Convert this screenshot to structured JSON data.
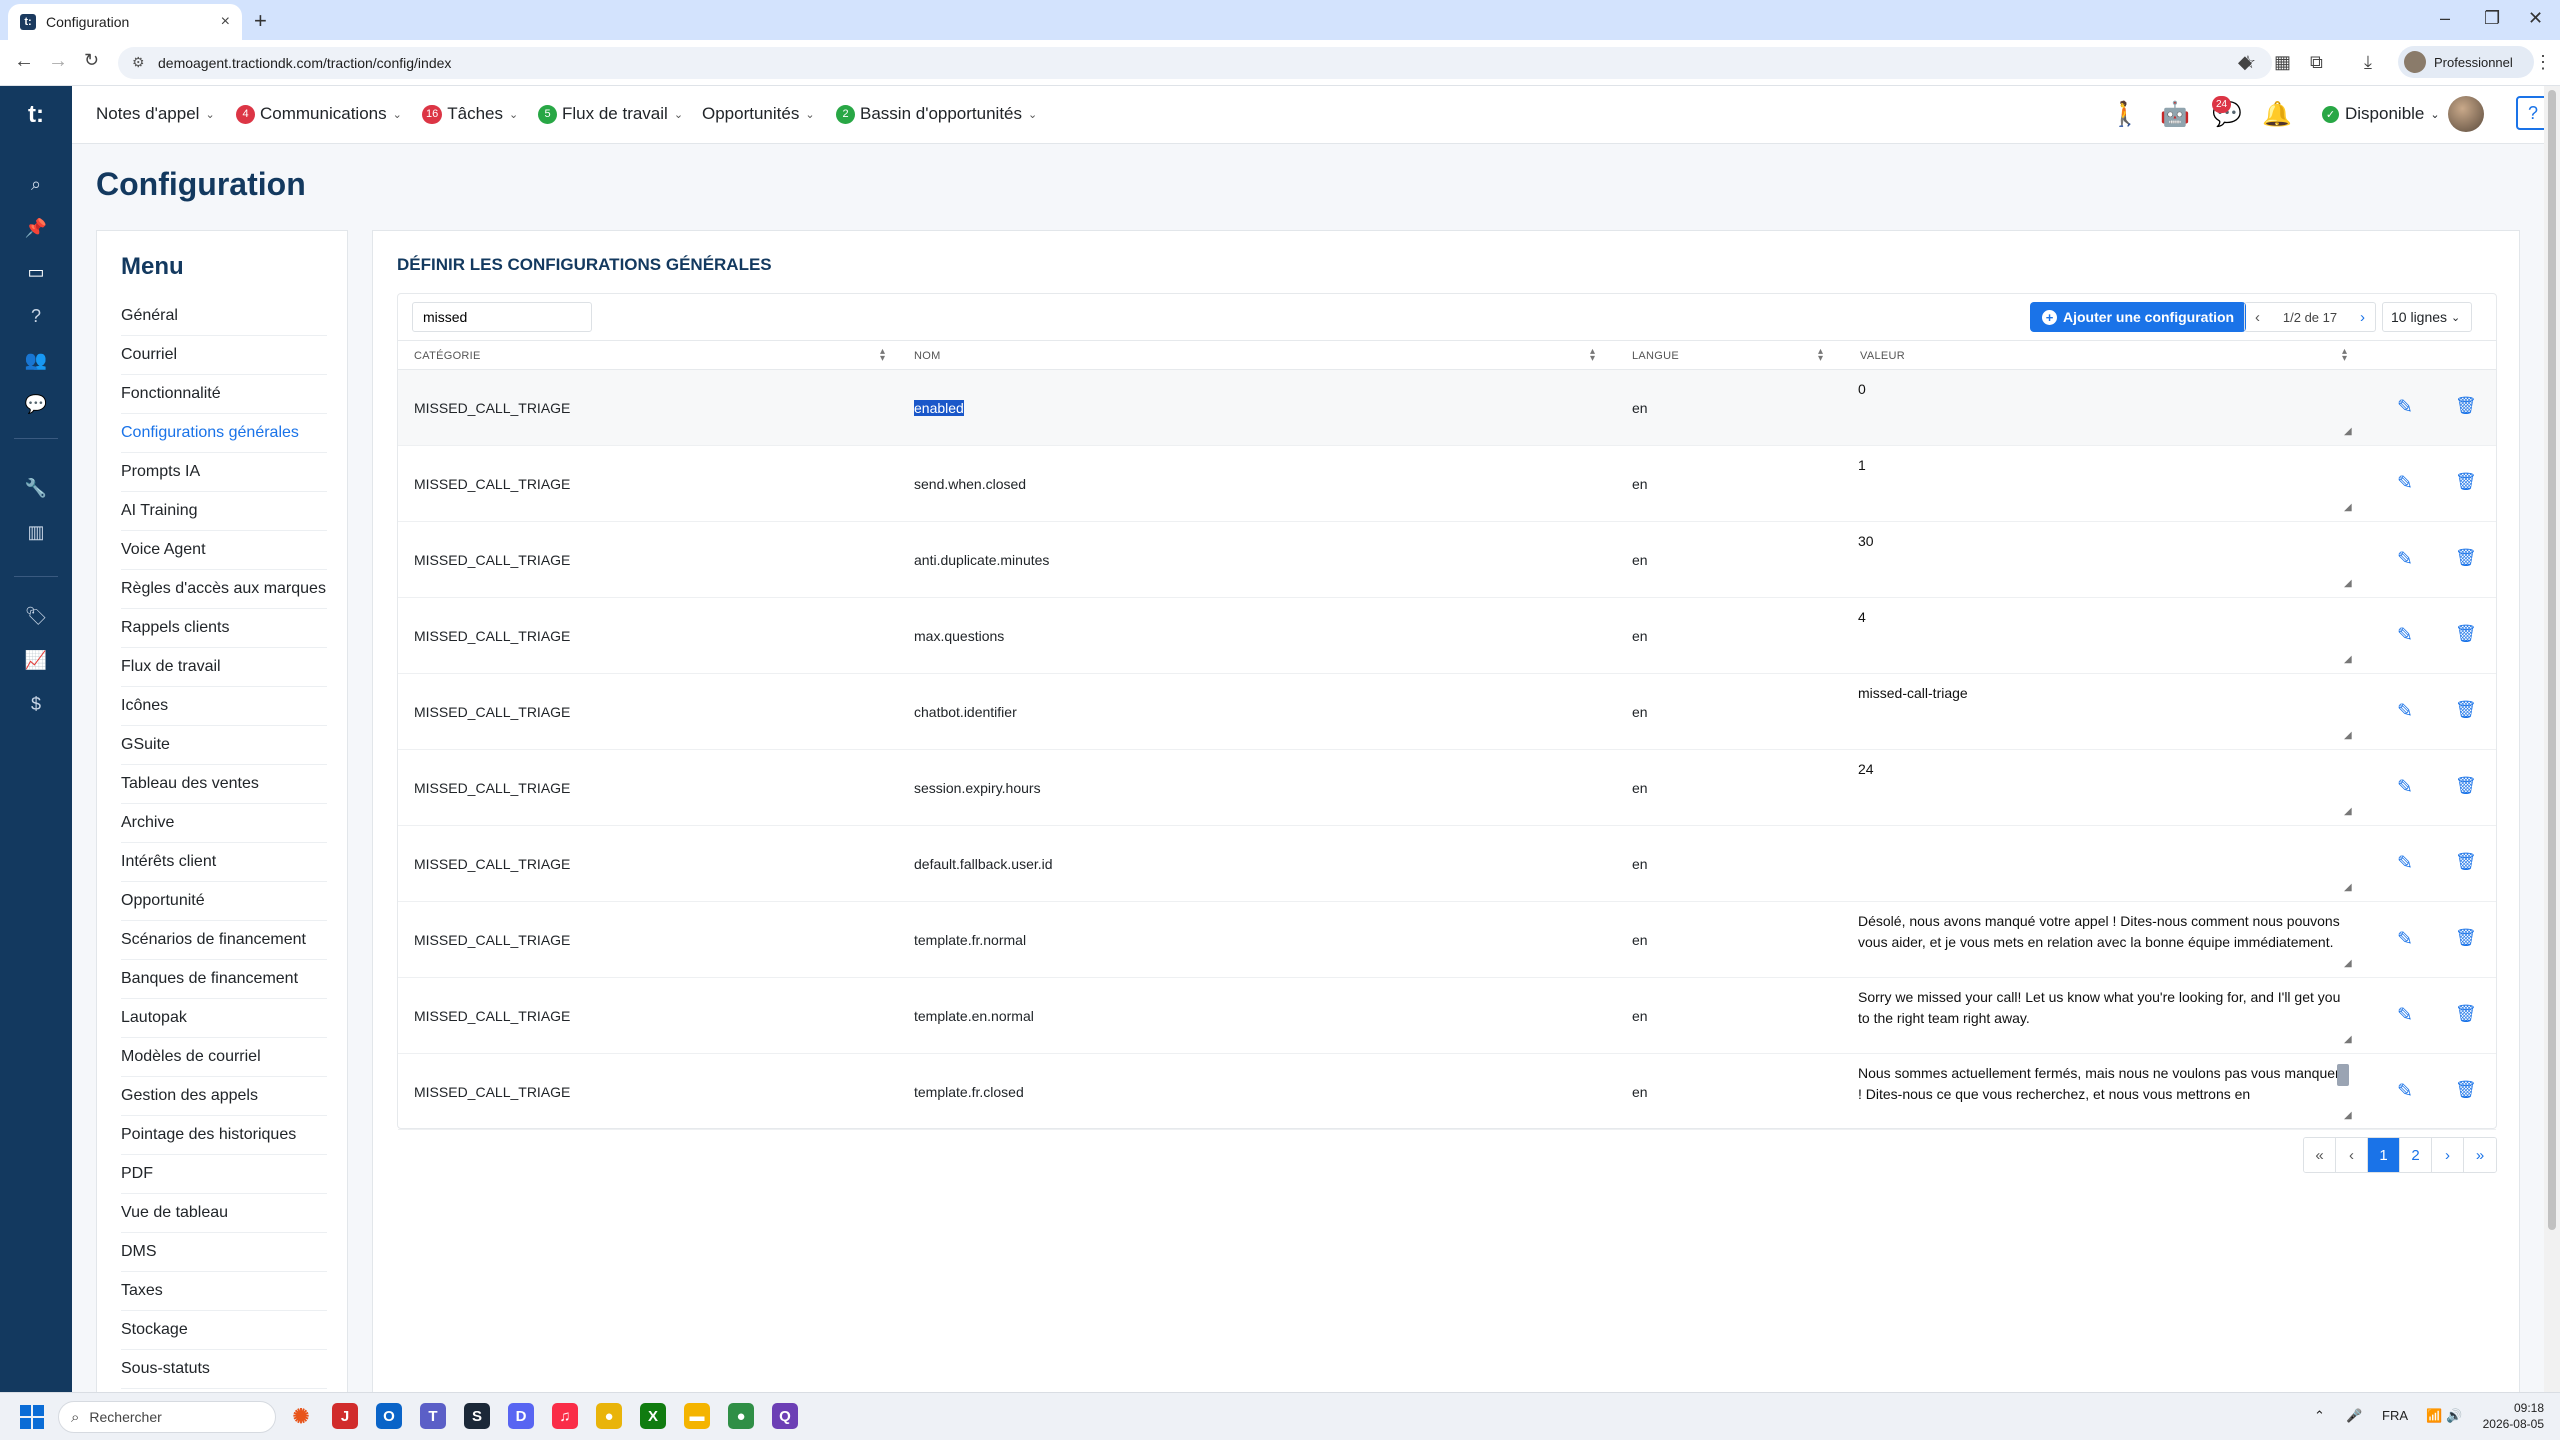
{
  "browser": {
    "tab_title": "Configuration",
    "url": "demoagent.tractiondk.com/traction/config/index",
    "profile_label": "Professionnel"
  },
  "rail": {
    "logo": "t:",
    "icons": [
      "search-icon",
      "pin-icon",
      "monitor-icon",
      "help-circle-icon",
      "users-icon",
      "chat-icon",
      "wrench-icon",
      "board-icon",
      "tag-icon",
      "chart-icon",
      "dollar-icon"
    ]
  },
  "nav": {
    "items": [
      {
        "label": "Notes d'appel",
        "badge": ""
      },
      {
        "label": "Communications",
        "badge": "4",
        "badge_color": "#dc3545"
      },
      {
        "label": "Tâches",
        "badge": "16",
        "badge_color": "#dc3545"
      },
      {
        "label": "Flux de travail",
        "badge": "5",
        "badge_color": "#28a745"
      },
      {
        "label": "Opportunités",
        "badge": ""
      },
      {
        "label": "Bassin d'opportunités",
        "badge": "2",
        "badge_color": "#28a745"
      }
    ],
    "notifications_count": "24",
    "status_label": "Disponible",
    "help_label": "?"
  },
  "page": {
    "title": "Configuration"
  },
  "menu": {
    "heading": "Menu",
    "items": [
      "Général",
      "Courriel",
      "Fonctionnalité",
      "Configurations générales",
      "Prompts IA",
      "AI Training",
      "Voice Agent",
      "Règles d'accès aux marques",
      "Rappels clients",
      "Flux de travail",
      "Icônes",
      "GSuite",
      "Tableau des ventes",
      "Archive",
      "Intérêts client",
      "Opportunité",
      "Scénarios de financement",
      "Banques de financement",
      "Lautopak",
      "Modèles de courriel",
      "Gestion des appels",
      "Pointage des historiques",
      "PDF",
      "Vue de tableau",
      "DMS",
      "Taxes",
      "Stockage",
      "Sous-statuts"
    ],
    "active_index": 3
  },
  "config": {
    "section_title": "DÉFINIR LES CONFIGURATIONS GÉNÉRALES",
    "search_value": "missed",
    "add_button": "Ajouter une configuration",
    "page_indicator": "1/2 de 17",
    "rows_per_page": "10 lignes",
    "columns": [
      "CATÉGORIE",
      "NOM",
      "LANGUE",
      "VALEUR"
    ],
    "rows": [
      {
        "category": "MISSED_CALL_TRIAGE",
        "name": "enabled",
        "lang": "en",
        "value": "0"
      },
      {
        "category": "MISSED_CALL_TRIAGE",
        "name": "send.when.closed",
        "lang": "en",
        "value": "1"
      },
      {
        "category": "MISSED_CALL_TRIAGE",
        "name": "anti.duplicate.minutes",
        "lang": "en",
        "value": "30"
      },
      {
        "category": "MISSED_CALL_TRIAGE",
        "name": "max.questions",
        "lang": "en",
        "value": "4"
      },
      {
        "category": "MISSED_CALL_TRIAGE",
        "name": "chatbot.identifier",
        "lang": "en",
        "value": "missed-call-triage"
      },
      {
        "category": "MISSED_CALL_TRIAGE",
        "name": "session.expiry.hours",
        "lang": "en",
        "value": "24"
      },
      {
        "category": "MISSED_CALL_TRIAGE",
        "name": "default.fallback.user.id",
        "lang": "en",
        "value": ""
      },
      {
        "category": "MISSED_CALL_TRIAGE",
        "name": "template.fr.normal",
        "lang": "en",
        "value": "Désolé, nous avons manqué votre appel ! Dites-nous comment nous pouvons vous aider, et je vous mets en relation avec la bonne équipe immédiatement."
      },
      {
        "category": "MISSED_CALL_TRIAGE",
        "name": "template.en.normal",
        "lang": "en",
        "value": "Sorry we missed your call! Let us know what you're looking for, and I'll get you to the right team right away."
      },
      {
        "category": "MISSED_CALL_TRIAGE",
        "name": "template.fr.closed",
        "lang": "en",
        "value": "Nous sommes actuellement fermés, mais nous ne voulons pas vous manquer ! Dites-nous ce que vous recherchez, et nous vous mettrons en"
      }
    ],
    "pagination": [
      "«",
      "‹",
      "1",
      "2",
      "›",
      "»"
    ],
    "current_page": "1"
  },
  "taskbar": {
    "search_placeholder": "Rechercher",
    "language": "FRA",
    "time": "09:18",
    "date": "2026-08-05"
  }
}
